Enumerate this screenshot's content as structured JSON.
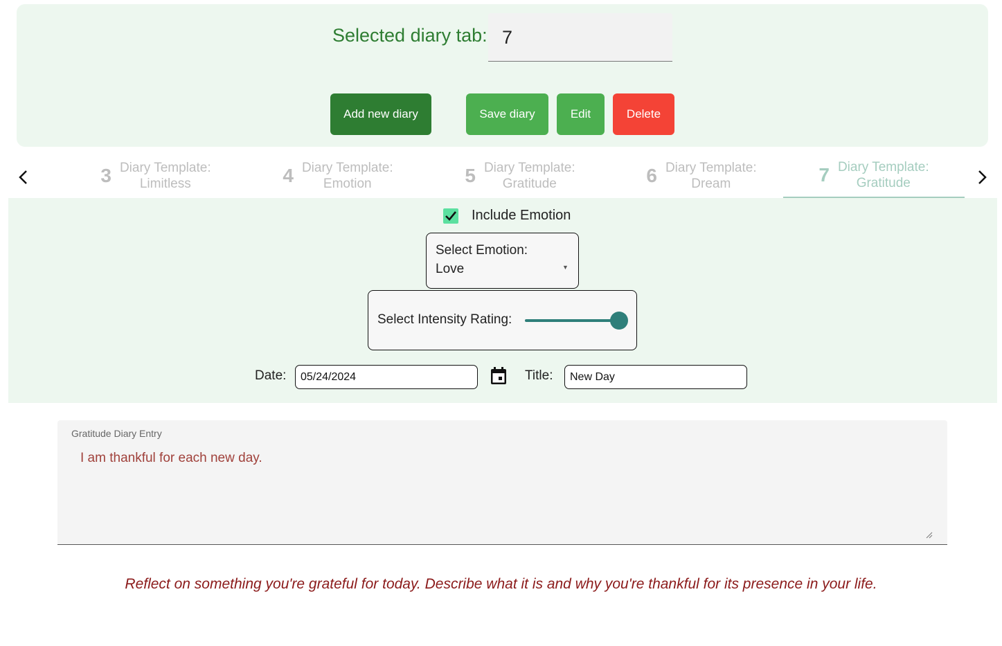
{
  "header": {
    "selected_tab_label": "Selected diary tab:",
    "selected_tab_value": "7"
  },
  "actions": {
    "add": "Add new diary",
    "save": "Save diary",
    "edit": "Edit",
    "delete": "Delete"
  },
  "tabs": [
    {
      "num": "3",
      "line1": "Diary Template:",
      "line2": "Limitless"
    },
    {
      "num": "4",
      "line1": "Diary Template:",
      "line2": "Emotion"
    },
    {
      "num": "5",
      "line1": "Diary Template:",
      "line2": "Gratitude"
    },
    {
      "num": "6",
      "line1": "Diary Template:",
      "line2": "Dream"
    },
    {
      "num": "7",
      "line1": "Diary Template:",
      "line2": "Gratitude",
      "active": true
    }
  ],
  "form": {
    "include_emotion_label": "Include Emotion",
    "include_emotion_checked": true,
    "select_emotion_label": "Select Emotion:",
    "select_emotion_value": "Love",
    "intensity_label": "Select Intensity Rating:",
    "intensity_value": 1.0,
    "date_label": "Date:",
    "date_value": "05/24/2024",
    "title_label": "Title:",
    "title_value": "New Day"
  },
  "entry": {
    "label": "Gratitude Diary Entry",
    "text": "I am thankful for each new day."
  },
  "prompt": "Reflect on something you're grateful for today. Describe what it is and why you're thankful for its presence in your life.",
  "colors": {
    "primary_dark": "#2e7d32",
    "primary": "#4caf50",
    "danger": "#f44336",
    "slider": "#2f7f7a",
    "entry_text": "#a0413b",
    "prompt_text": "#8b1a1a"
  }
}
